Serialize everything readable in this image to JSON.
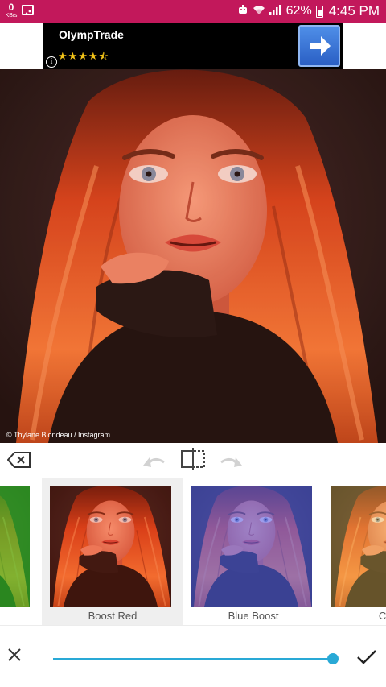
{
  "status_bar": {
    "speed_value": "0",
    "speed_unit": "KB/s",
    "battery_percent": "62%",
    "time": "4:45 PM",
    "background_color": "#c2185b"
  },
  "ad": {
    "title": "OlympTrade",
    "rating_stars": "★★★★⯪",
    "info_glyph": "i"
  },
  "photo": {
    "credit": "© Thylane Blondeau / Instagram"
  },
  "toolbar": {
    "icons": [
      "backspace-icon",
      "undo-icon",
      "compare-icon",
      "redo-icon"
    ]
  },
  "filters": {
    "items": [
      {
        "label": "Boost Red",
        "selected": true
      },
      {
        "label": "Blue Boost",
        "selected": false
      },
      {
        "label": "Colour",
        "selected": false
      }
    ]
  },
  "bottom_bar": {
    "slider_value": 1.0,
    "accent_color": "#29a9d6",
    "icons": [
      "close-icon",
      "checkmark-icon"
    ]
  }
}
